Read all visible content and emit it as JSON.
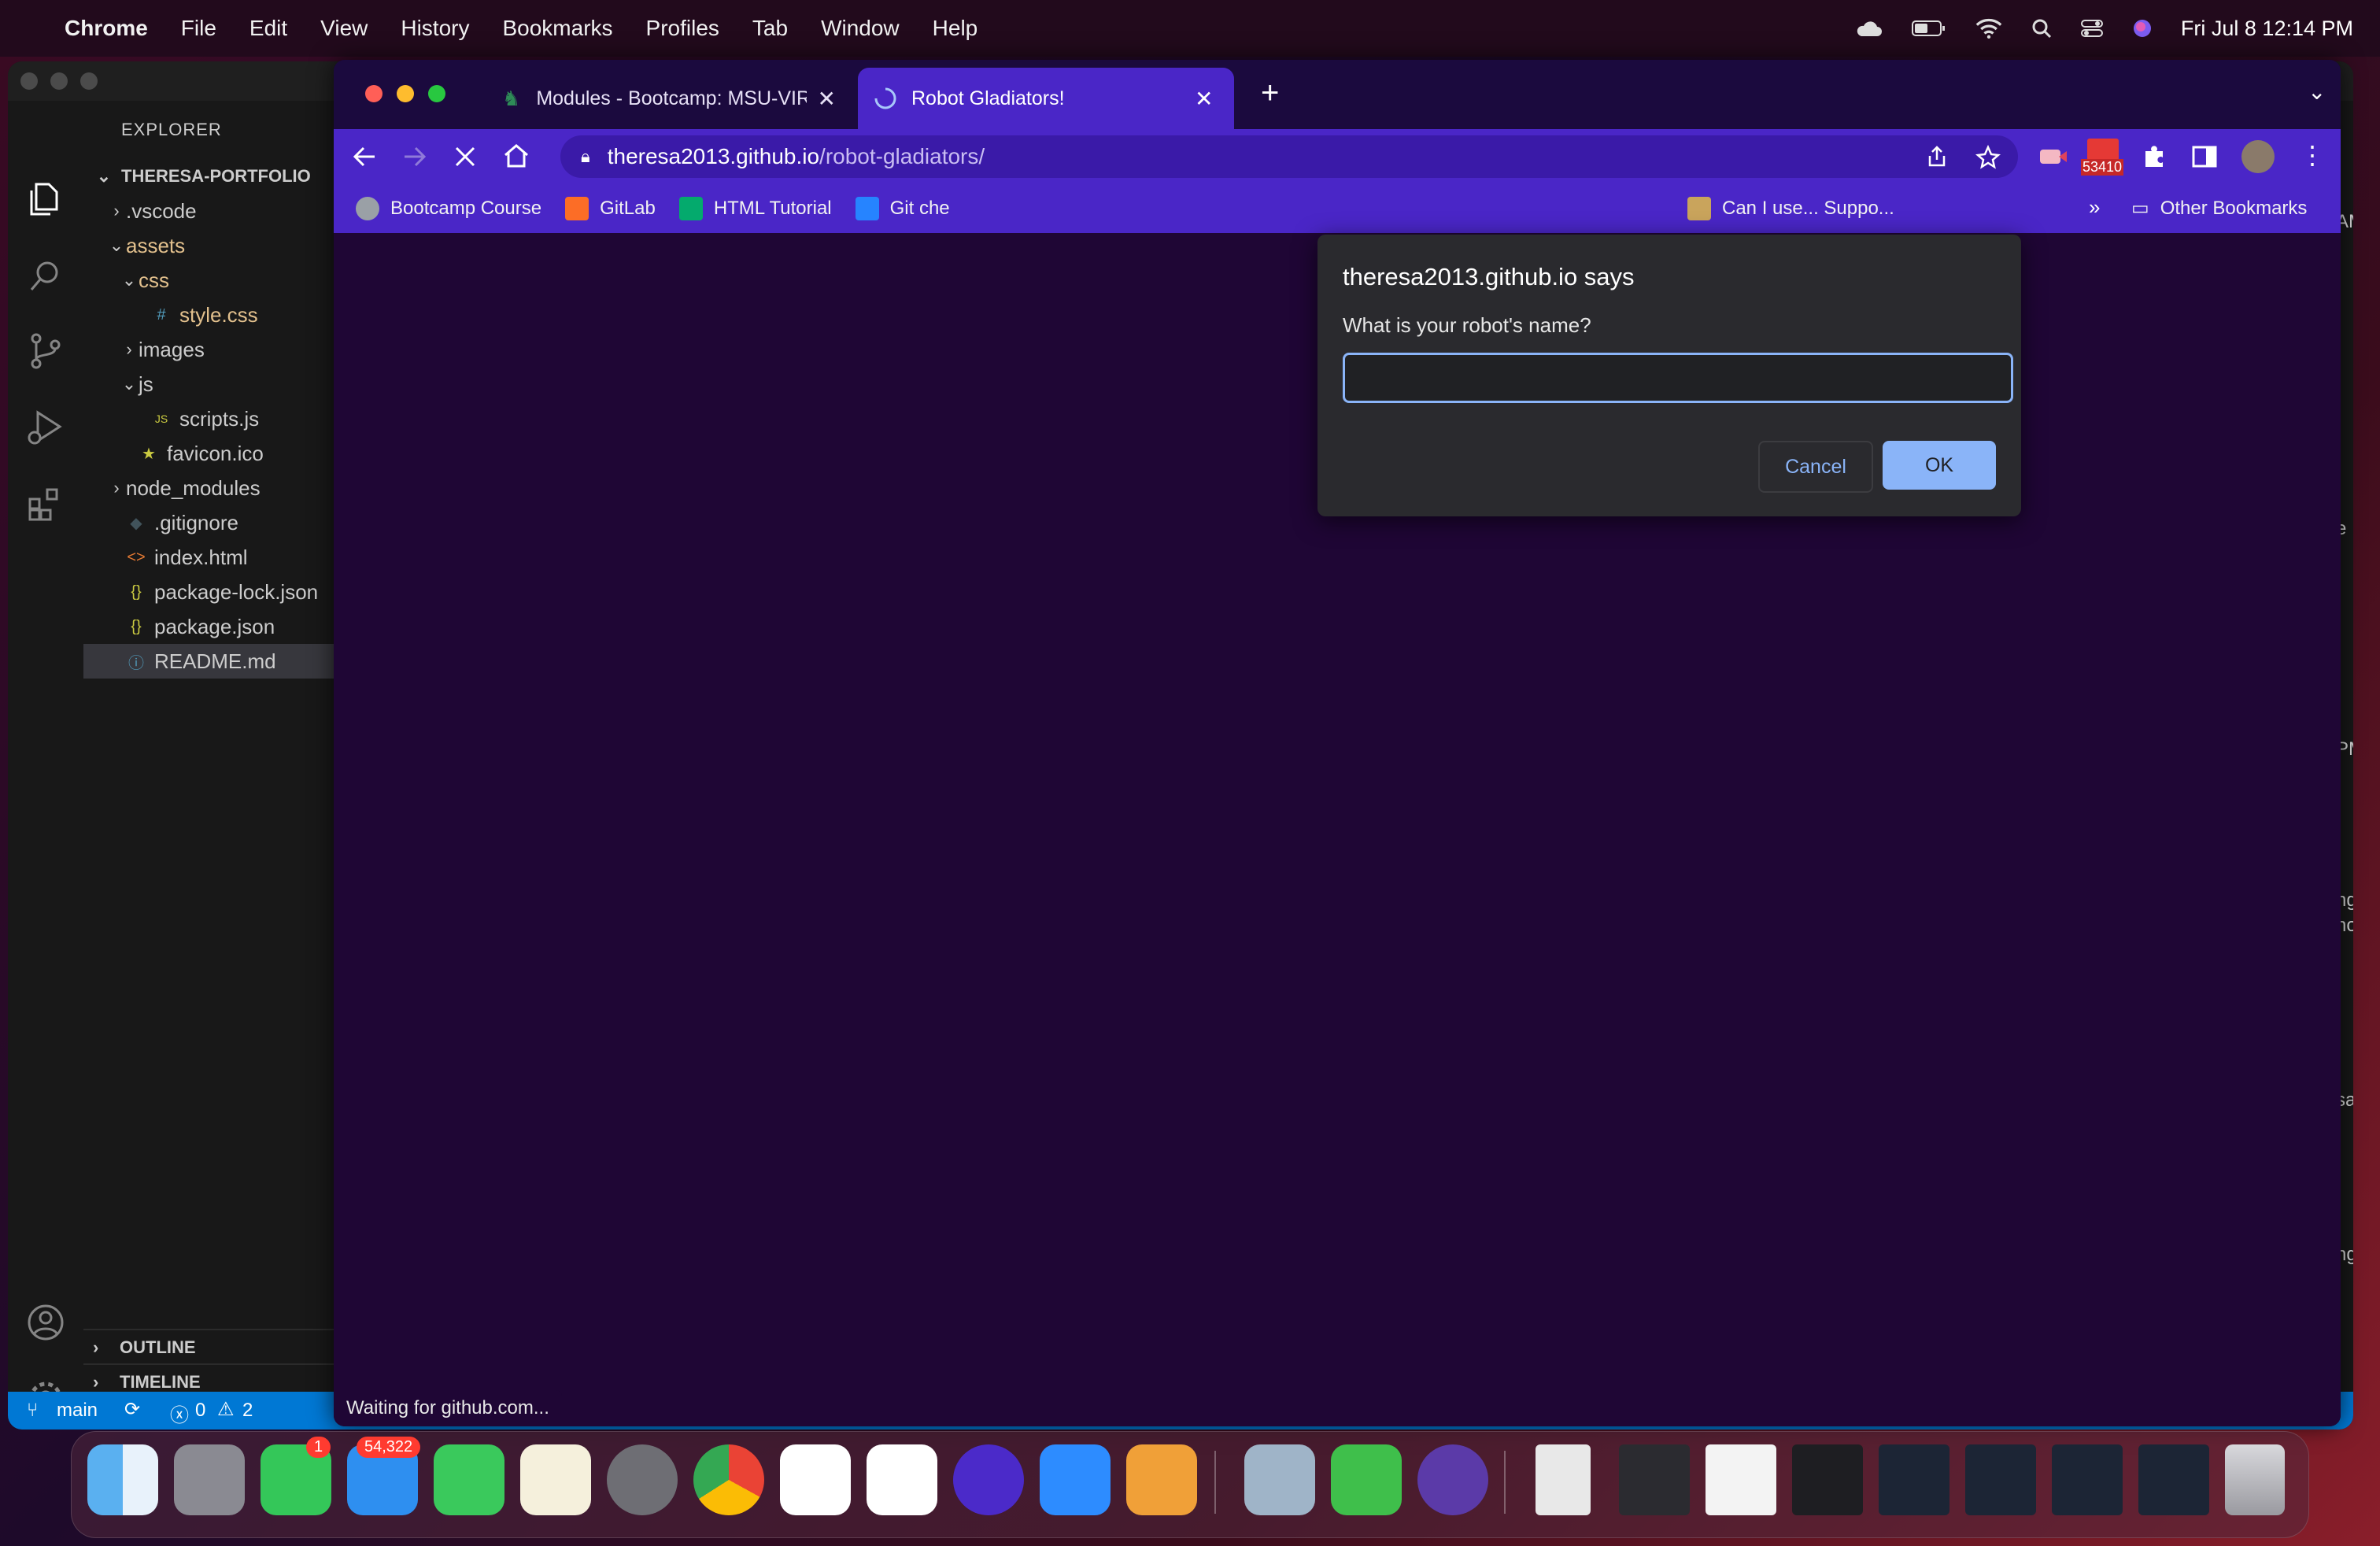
{
  "menubar": {
    "app": "Chrome",
    "items": [
      "File",
      "Edit",
      "View",
      "History",
      "Bookmarks",
      "Profiles",
      "Tab",
      "Window",
      "Help"
    ],
    "clock": "Fri Jul 8  12:14 PM"
  },
  "vscode": {
    "explorer_title": "EXPLORER",
    "root": "THERESA-PORTFOLIO",
    "tree": [
      {
        "label": ".vscode",
        "chev": "›",
        "icon": "",
        "indent": 1,
        "color": "#cccccc"
      },
      {
        "label": "assets",
        "chev": "⌄",
        "icon": "",
        "indent": 1,
        "color": "#e2c08d"
      },
      {
        "label": "css",
        "chev": "⌄",
        "icon": "",
        "indent": 2,
        "color": "#e2c08d"
      },
      {
        "label": "style.css",
        "chev": "",
        "icon": "#",
        "indent": 3,
        "color": "#e2c08d"
      },
      {
        "label": "images",
        "chev": "›",
        "icon": "",
        "indent": 2,
        "color": "#cccccc"
      },
      {
        "label": "js",
        "chev": "⌄",
        "icon": "",
        "indent": 2,
        "color": "#cccccc"
      },
      {
        "label": "scripts.js",
        "chev": "",
        "icon": "JS",
        "indent": 3,
        "color": "#cccccc"
      },
      {
        "label": "favicon.ico",
        "chev": "",
        "icon": "★",
        "indent": 2,
        "color": "#cccccc"
      },
      {
        "label": "node_modules",
        "chev": "›",
        "icon": "",
        "indent": 1,
        "color": "#cccccc"
      },
      {
        "label": ".gitignore",
        "chev": "",
        "icon": "◆",
        "indent": 1,
        "color": "#cccccc"
      },
      {
        "label": "index.html",
        "chev": "",
        "icon": "<>",
        "indent": 1,
        "color": "#cccccc"
      },
      {
        "label": "package-lock.json",
        "chev": "",
        "icon": "{}",
        "indent": 1,
        "color": "#cccccc"
      },
      {
        "label": "package.json",
        "chev": "",
        "icon": "{}",
        "indent": 1,
        "color": "#cccccc"
      },
      {
        "label": "README.md",
        "chev": "",
        "icon": "ⓘ",
        "indent": 1,
        "color": "#cccccc",
        "selected": true
      }
    ],
    "outline": "OUTLINE",
    "timeline": "TIMELINE",
    "status": {
      "branch": "main",
      "errors": "0",
      "warnings": "2"
    },
    "right_peek": [
      "AM",
      "e",
      "PM",
      "ng",
      "nov",
      "sal",
      "ng"
    ]
  },
  "chrome": {
    "tabs": [
      {
        "title": "Modules - Bootcamp: MSU-VIR"
      },
      {
        "title": "Robot Gladiators!",
        "active": true
      }
    ],
    "url_host": "theresa2013.github.io",
    "url_path": "/robot-gladiators/",
    "mail_badge": "53410",
    "bookmarks": [
      "Bootcamp Course",
      "GitLab",
      "HTML Tutorial",
      "Git che",
      "Can I use... Suppo..."
    ],
    "bookmarks_more": "»",
    "other_bookmarks": "Other Bookmarks",
    "status_text": "Waiting for github.com..."
  },
  "dialog": {
    "title": "theresa2013.github.io says",
    "prompt": "What is your robot's name?",
    "input_value": "",
    "cancel": "Cancel",
    "ok": "OK"
  },
  "dock": {
    "messages_badge": "1",
    "mail_badge": "54,322"
  },
  "colors": {
    "chrome_theme": "#4a26c7",
    "page_bg": "#1f0635",
    "vscode_status": "#0078d4",
    "ok_button": "#8ab4f8"
  }
}
